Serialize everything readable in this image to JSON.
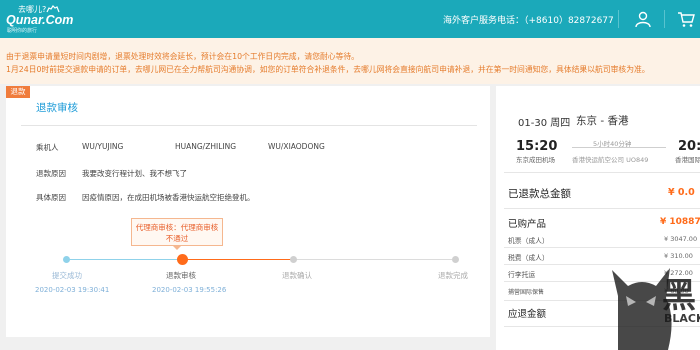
{
  "header": {
    "logo_top": "去哪儿?",
    "logo_main": "Qunar.Com",
    "logo_sub": "聪明你的旅行",
    "hotline": "海外客户服务电话：（+8610）82872677"
  },
  "notice": {
    "line1": "由于退票申请量短时间内剧增，退票处理时效将会延长，预计会在10个工作日内完成，请您耐心等待。",
    "line2": "1月24日0时前提交退款申请的订单，去哪儿网已在全力帮航司沟通协调，如您的订单符合补退条件，去哪儿网将会直接向航司申请补退，并在第一时间通知您，具体结果以航司审核为准。"
  },
  "refund": {
    "tag": "退款",
    "title": "退款审核",
    "passenger_label": "乘机人",
    "passengers": [
      "WU/YUJING",
      "HUANG/ZHILING",
      "WU/XIAODONG"
    ],
    "reason_label": "退款原因",
    "reason": "我要改变行程计划、我不想飞了",
    "detail_label": "具体原因",
    "detail": "因疫情原因，在成田机场被香港快运航空拒绝登机。",
    "tooltip_line1": "代理商审核：代理商审核",
    "tooltip_line2": "不通过",
    "steps": [
      {
        "label": "提交成功",
        "time": "2020-02-03 19:30:41"
      },
      {
        "label": "退款审核",
        "time": "2020-02-03 19:55:26"
      },
      {
        "label": "退款确认",
        "time": ""
      },
      {
        "label": "退款完成",
        "time": ""
      }
    ]
  },
  "flight": {
    "date": "01-30 周四",
    "route": "东京 - 香港",
    "dep_time": "15:20",
    "arr_time": "20:0",
    "duration": "5小时40分钟",
    "dep_airport": "东京成田机场",
    "carrier": "香港快运航空公司 UO849",
    "arr_airport": "香港国际机"
  },
  "summary": {
    "refunded_total_label": "已退款总金额",
    "refunded_total_value": "¥ 0.0",
    "purchased_label": "已购产品",
    "purchased_value": "¥ 10887",
    "items": [
      {
        "label": "机票（成人）",
        "value": "¥ 3047.00"
      },
      {
        "label": "税费（成人）",
        "value": "¥ 310.00"
      },
      {
        "label": "行李托运",
        "value": "¥ 272.00"
      },
      {
        "label": "捕营国际保售",
        "value": "¥ 60.00"
      }
    ],
    "refundable_label": "应退金额"
  },
  "watermark": {
    "char": "黑",
    "latin": "BLACK"
  },
  "colors": {
    "brand": "#1ba9ba",
    "accent_orange": "#ff6b1a",
    "link_blue": "#1f9cd8",
    "notice_text": "#e57b2b"
  }
}
